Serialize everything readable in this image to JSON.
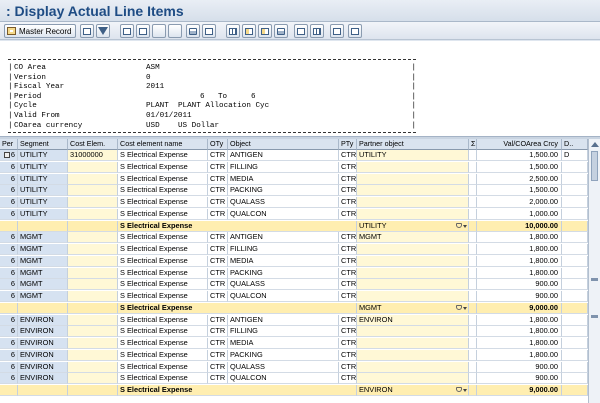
{
  "window": {
    "title": ": Display Actual Line Items"
  },
  "toolbar": {
    "master_record_label": "Master Record",
    "icons": [
      "details-icon",
      "filter-icon",
      "sort-ascending-icon",
      "sort-descending-icon",
      "sum-icon",
      "subtotal-icon",
      "print-icon",
      "export-icon",
      "layout-icon",
      "change-layout-icon",
      "select-layout-icon",
      "save-layout-icon",
      "abc-analysis-icon",
      "graphic-icon",
      "mail-icon",
      "refresh-icon"
    ]
  },
  "report_header": {
    "rows": [
      {
        "label": "CO Area",
        "value": "ASM"
      },
      {
        "label": "Version",
        "value": "0"
      },
      {
        "label": "Fiscal Year",
        "value": "2011"
      },
      {
        "label": "Period",
        "value": "6",
        "value_to_label": "To",
        "value_to": "6"
      },
      {
        "label": "Cycle",
        "value": "PLANT",
        "value_desc": "PLANT Allocation Cyc"
      },
      {
        "label": "Valid From",
        "value": "01/01/2011"
      },
      {
        "label": "COarea currency",
        "value": "USD",
        "value_desc": "US Dollar"
      }
    ]
  },
  "table": {
    "columns": [
      {
        "key": "per",
        "label": "Per"
      },
      {
        "key": "segment",
        "label": "Segment"
      },
      {
        "key": "cost_elem",
        "label": "Cost Elem."
      },
      {
        "key": "cost_elem_name",
        "label": "Cost element name"
      },
      {
        "key": "oty",
        "label": "OTy"
      },
      {
        "key": "object",
        "label": "Object"
      },
      {
        "key": "pty",
        "label": "PTy"
      },
      {
        "key": "partner",
        "label": "Partner object"
      },
      {
        "key": "sum",
        "label": "Σ"
      },
      {
        "key": "val",
        "label": "Val/COArea Crcy"
      },
      {
        "key": "d",
        "label": "D.."
      }
    ],
    "rows": [
      {
        "type": "item",
        "per": "6",
        "segment": "UTILITY",
        "cost_elem": "31000000",
        "cost_elem_name": "S Electrical Expense",
        "oty": "CTR",
        "object": "ANTIGEN",
        "pty": "CTR",
        "partner": "UTILITY",
        "val": "1,500.00",
        "d": "D",
        "selected": true
      },
      {
        "type": "item",
        "per": "6",
        "segment": "UTILITY",
        "cost_elem": "",
        "cost_elem_name": "S Electrical Expense",
        "oty": "CTR",
        "object": "FILLING",
        "pty": "CTR",
        "partner": "",
        "val": "1,500.00",
        "d": ""
      },
      {
        "type": "item",
        "per": "6",
        "segment": "UTILITY",
        "cost_elem": "",
        "cost_elem_name": "S Electrical Expense",
        "oty": "CTR",
        "object": "MEDIA",
        "pty": "CTR",
        "partner": "",
        "val": "2,500.00",
        "d": ""
      },
      {
        "type": "item",
        "per": "6",
        "segment": "UTILITY",
        "cost_elem": "",
        "cost_elem_name": "S Electrical Expense",
        "oty": "CTR",
        "object": "PACKING",
        "pty": "CTR",
        "partner": "",
        "val": "1,500.00",
        "d": ""
      },
      {
        "type": "item",
        "per": "6",
        "segment": "UTILITY",
        "cost_elem": "",
        "cost_elem_name": "S Electrical Expense",
        "oty": "CTR",
        "object": "QUALASS",
        "pty": "CTR",
        "partner": "",
        "val": "2,000.00",
        "d": ""
      },
      {
        "type": "item",
        "per": "6",
        "segment": "UTILITY",
        "cost_elem": "",
        "cost_elem_name": "S Electrical Expense",
        "oty": "CTR",
        "object": "QUALCON",
        "pty": "CTR",
        "partner": "",
        "val": "1,000.00",
        "d": ""
      },
      {
        "type": "subtotal",
        "cost_elem_name": "S Electrical Expense",
        "partner": "UTILITY",
        "val": "10,000.00"
      },
      {
        "type": "item",
        "per": "6",
        "segment": "MGMT",
        "cost_elem": "",
        "cost_elem_name": "S Electrical Expense",
        "oty": "CTR",
        "object": "ANTIGEN",
        "pty": "CTR",
        "partner": "MGMT",
        "val": "1,800.00",
        "d": ""
      },
      {
        "type": "item",
        "per": "6",
        "segment": "MGMT",
        "cost_elem": "",
        "cost_elem_name": "S Electrical Expense",
        "oty": "CTR",
        "object": "FILLING",
        "pty": "CTR",
        "partner": "",
        "val": "1,800.00",
        "d": ""
      },
      {
        "type": "item",
        "per": "6",
        "segment": "MGMT",
        "cost_elem": "",
        "cost_elem_name": "S Electrical Expense",
        "oty": "CTR",
        "object": "MEDIA",
        "pty": "CTR",
        "partner": "",
        "val": "1,800.00",
        "d": ""
      },
      {
        "type": "item",
        "per": "6",
        "segment": "MGMT",
        "cost_elem": "",
        "cost_elem_name": "S Electrical Expense",
        "oty": "CTR",
        "object": "PACKING",
        "pty": "CTR",
        "partner": "",
        "val": "1,800.00",
        "d": ""
      },
      {
        "type": "item",
        "per": "6",
        "segment": "MGMT",
        "cost_elem": "",
        "cost_elem_name": "S Electrical Expense",
        "oty": "CTR",
        "object": "QUALASS",
        "pty": "CTR",
        "partner": "",
        "val": "900.00",
        "d": ""
      },
      {
        "type": "item",
        "per": "6",
        "segment": "MGMT",
        "cost_elem": "",
        "cost_elem_name": "S Electrical Expense",
        "oty": "CTR",
        "object": "QUALCON",
        "pty": "CTR",
        "partner": "",
        "val": "900.00",
        "d": ""
      },
      {
        "type": "subtotal",
        "cost_elem_name": "S Electrical Expense",
        "partner": "MGMT",
        "val": "9,000.00"
      },
      {
        "type": "item",
        "per": "6",
        "segment": "ENVIRON",
        "cost_elem": "",
        "cost_elem_name": "S Electrical Expense",
        "oty": "CTR",
        "object": "ANTIGEN",
        "pty": "CTR",
        "partner": "ENVIRON",
        "val": "1,800.00",
        "d": ""
      },
      {
        "type": "item",
        "per": "6",
        "segment": "ENVIRON",
        "cost_elem": "",
        "cost_elem_name": "S Electrical Expense",
        "oty": "CTR",
        "object": "FILLING",
        "pty": "CTR",
        "partner": "",
        "val": "1,800.00",
        "d": ""
      },
      {
        "type": "item",
        "per": "6",
        "segment": "ENVIRON",
        "cost_elem": "",
        "cost_elem_name": "S Electrical Expense",
        "oty": "CTR",
        "object": "MEDIA",
        "pty": "CTR",
        "partner": "",
        "val": "1,800.00",
        "d": ""
      },
      {
        "type": "item",
        "per": "6",
        "segment": "ENVIRON",
        "cost_elem": "",
        "cost_elem_name": "S Electrical Expense",
        "oty": "CTR",
        "object": "PACKING",
        "pty": "CTR",
        "partner": "",
        "val": "1,800.00",
        "d": ""
      },
      {
        "type": "item",
        "per": "6",
        "segment": "ENVIRON",
        "cost_elem": "",
        "cost_elem_name": "S Electrical Expense",
        "oty": "CTR",
        "object": "QUALASS",
        "pty": "CTR",
        "partner": "",
        "val": "900.00",
        "d": ""
      },
      {
        "type": "item",
        "per": "6",
        "segment": "ENVIRON",
        "cost_elem": "",
        "cost_elem_name": "S Electrical Expense",
        "oty": "CTR",
        "object": "QUALCON",
        "pty": "CTR",
        "partner": "",
        "val": "900.00",
        "d": ""
      },
      {
        "type": "subtotal",
        "cost_elem_name": "S Electrical Expense",
        "partner": "ENVIRON",
        "val": "9,000.00"
      }
    ]
  }
}
